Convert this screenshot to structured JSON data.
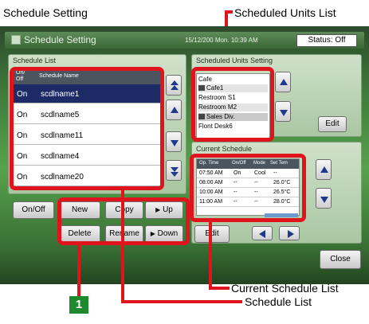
{
  "annotations": {
    "title_label": "Schedule Setting",
    "scheduled_units_label": "Scheduled Units List",
    "current_schedule_label": "Current Schedule List",
    "schedule_list_label": "Schedule List",
    "badge_number": "1"
  },
  "window": {
    "title": "Schedule Setting",
    "datetime": "15/12/200 Mon. 10:39 AM",
    "status": "Status: Off"
  },
  "schedule_list": {
    "title": "Schedule List",
    "col_onoff": "On/ Off",
    "col_name": "Schedule Name",
    "rows": [
      {
        "onoff": "On",
        "name": "scdlname1",
        "selected": true
      },
      {
        "onoff": "On",
        "name": "scdlname5",
        "selected": false
      },
      {
        "onoff": "On",
        "name": "scdlname11",
        "selected": false
      },
      {
        "onoff": "On",
        "name": "scdlname4",
        "selected": false
      },
      {
        "onoff": "On",
        "name": "scdlname20",
        "selected": false
      }
    ]
  },
  "buttons": {
    "onoff": "On/Off",
    "new": "New",
    "copy": "Copy",
    "up": "Up",
    "delete": "Delete",
    "rename": "Rename",
    "down": "Down",
    "edit_units": "Edit",
    "edit_schedule": "Edit",
    "close": "Close"
  },
  "scheduled_units": {
    "title": "Scheduled Units Setting",
    "items": [
      "Cafe",
      "Cafe1",
      "Restroom S1",
      "Restroom M2",
      "Sales Div.",
      "Flont Desk6"
    ]
  },
  "current_schedule": {
    "title": "Current Schedule",
    "columns": [
      "Op. Time",
      "On/Off",
      "Mode",
      "Set Tem"
    ],
    "rows": [
      [
        "07:50 AM",
        "On",
        "Cool",
        "--"
      ],
      [
        "08:00 AM",
        "--",
        "--",
        "26.0°C"
      ],
      [
        "10:00 AM",
        "--",
        "--",
        "26.5°C"
      ],
      [
        "11:00 AM",
        "--",
        "--",
        "28.0°C"
      ]
    ]
  },
  "colors": {
    "annotation_red": "#e0141c",
    "badge_green": "#1f8a2d",
    "selected_row": "#1c2b66"
  }
}
